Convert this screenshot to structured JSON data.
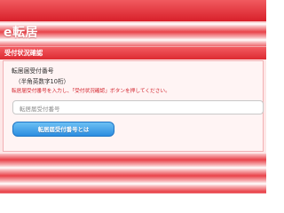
{
  "header": {
    "logo": "e転居"
  },
  "section": {
    "title": "受付状況確認"
  },
  "form": {
    "label": "転居届受付番号",
    "label_note": "（半角英数字10桁）",
    "hint": "転居届受付番号を入力し、「受付状況確認」ボタンを押してください。",
    "input_placeholder": "転居届受付番号",
    "help_button": "転居届受付番号とは"
  }
}
